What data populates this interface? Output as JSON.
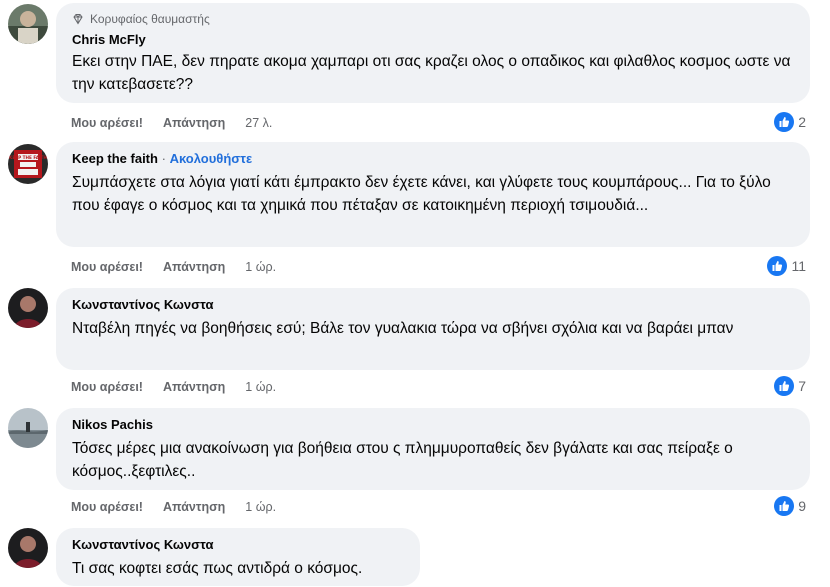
{
  "comments": [
    {
      "badge": "Κορυφαίος θαυμαστής",
      "author": "Chris McFly",
      "follow": "",
      "text": "Εκει στην ΠΑΕ, δεν πηρατε ακομα χαμπαρι οτι σας κραζει ολος ο οπαδικος και φιλαθλος κοσμος ωστε να την κατεβασετε??",
      "like": "Μου αρέσει!",
      "reply": "Απάντηση",
      "time": "27 λ.",
      "reactions": "2"
    },
    {
      "badge": "",
      "author": "Keep the faith",
      "follow": "Ακολουθήστε",
      "text": "Συμπάσχετε στα λόγια γιατί κάτι έμπρακτο δεν έχετε κάνει, και γλύφετε τους κουμπάρους... Για το ξύλο που έφαγε ο κόσμος και τα χημικά που πέταξαν σε κατοικημένη περιοχή τσιμουδιά...",
      "like": "Μου αρέσει!",
      "reply": "Απάντηση",
      "time": "1 ώρ.",
      "reactions": "11"
    },
    {
      "badge": "",
      "author": "Κωνσταντίνος Κωνστα",
      "follow": "",
      "text": "Νταβέλη πηγές να βοηθήσεις εσύ; Βάλε τον γυαλακια τώρα να σβήνει σχόλια και να βαράει μπαν",
      "like": "Μου αρέσει!",
      "reply": "Απάντηση",
      "time": "1 ώρ.",
      "reactions": "7"
    },
    {
      "badge": "",
      "author": "Nikos Pachis",
      "follow": "",
      "text": "Τόσες μέρες μια ανακοίνωση για βοήθεια στου ς πλημμυροπαθείς δεν βγάλατε και σας πείραξε ο κόσμος..ξεφτιλες..",
      "like": "Μου αρέσει!",
      "reply": "Απάντηση",
      "time": "1 ώρ.",
      "reactions": "9"
    },
    {
      "badge": "",
      "author": "Κωνσταντίνος Κωνστα",
      "follow": "",
      "text": "Τι σας κοφτει εσάς πως αντιδρά ο κόσμος.",
      "like": "",
      "reply": "",
      "time": "",
      "reactions": ""
    }
  ],
  "avatar_thumbnail_text": "KEEP THE FAITH",
  "colors": {
    "bubble": "#f0f2f5",
    "link": "#216fdb",
    "like_blue": "#1877f2",
    "meta": "#65676b"
  }
}
